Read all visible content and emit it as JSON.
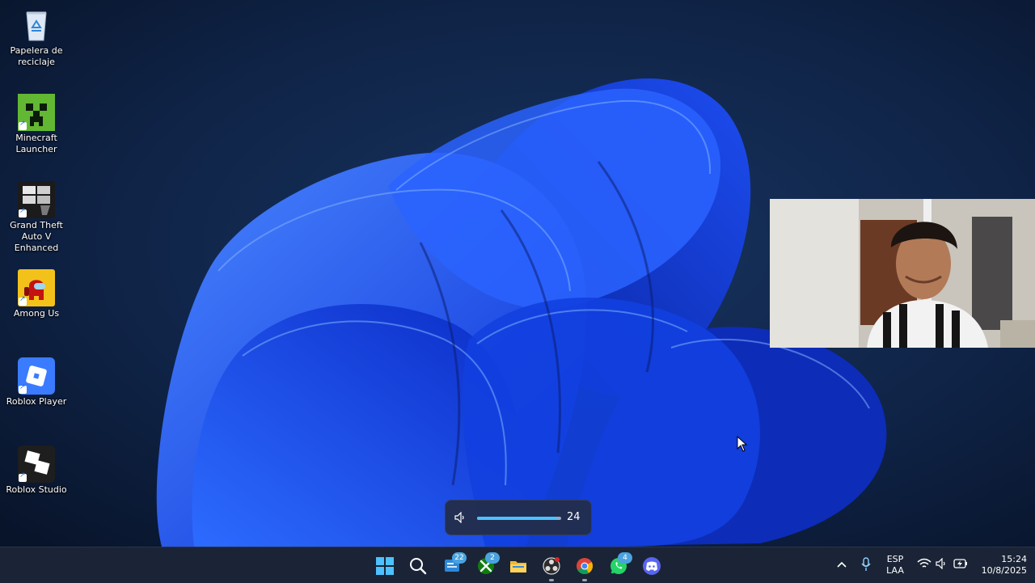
{
  "desktop": {
    "icons": [
      {
        "label": "Papelera de reciclaje",
        "icon": "recycle-bin-icon"
      },
      {
        "label": "Minecraft Launcher",
        "icon": "minecraft-creeper-icon"
      },
      {
        "label": "Grand Theft Auto V Enhanced",
        "icon": "gta-v-icon"
      },
      {
        "label": "Among Us",
        "icon": "among-us-icon"
      },
      {
        "label": "Roblox Player",
        "icon": "roblox-player-icon"
      },
      {
        "label": "Roblox Studio",
        "icon": "roblox-studio-icon"
      }
    ]
  },
  "volume": {
    "icon": "speaker-icon",
    "level": 24,
    "level_label": "24",
    "accent": "#4cc2ff"
  },
  "taskbar": {
    "apps": [
      {
        "name": "start",
        "icon": "windows-start-icon"
      },
      {
        "name": "search",
        "icon": "search-icon"
      },
      {
        "name": "widgets",
        "icon": "widgets-icon",
        "badge": "22"
      },
      {
        "name": "xbox",
        "icon": "xbox-icon",
        "badge": "2"
      },
      {
        "name": "file-explorer",
        "icon": "folder-icon"
      },
      {
        "name": "obs",
        "icon": "obs-icon"
      },
      {
        "name": "chrome",
        "icon": "chrome-icon"
      },
      {
        "name": "whatsapp",
        "icon": "whatsapp-icon",
        "badge": "4"
      },
      {
        "name": "discord",
        "icon": "discord-icon"
      }
    ],
    "tray": {
      "language_line1": "ESP",
      "language_line2": "LAA",
      "time": "15:24",
      "date": "10/8/2025"
    }
  },
  "colors": {
    "taskbar_bg": "#1a2436",
    "wallpaper_bloom": "#1f5bff"
  }
}
